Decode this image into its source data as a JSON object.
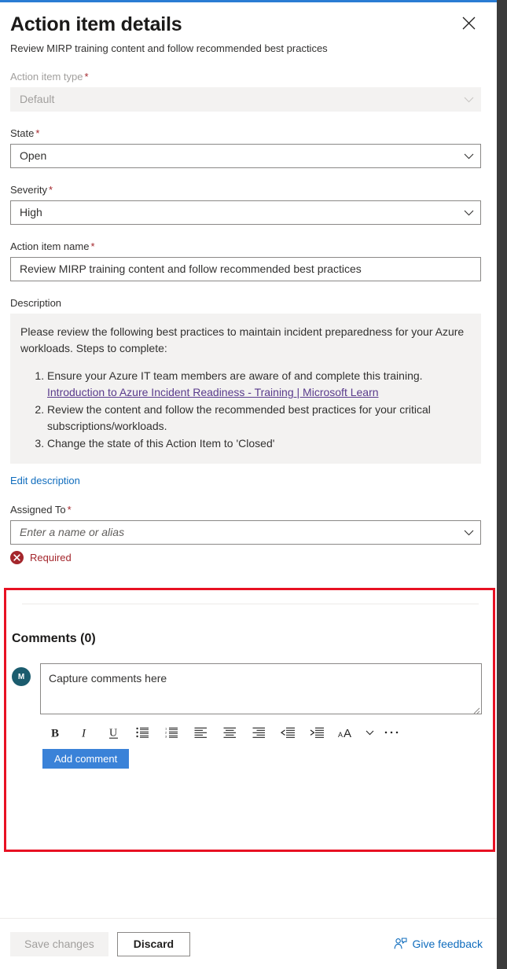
{
  "header": {
    "title": "Action item details",
    "subtitle": "Review MIRP training content and follow recommended best practices",
    "close_label": "Close"
  },
  "fields": {
    "action_item_type": {
      "label": "Action item type",
      "required_mark": "*",
      "value": "Default",
      "disabled": true
    },
    "state": {
      "label": "State",
      "required_mark": "*",
      "value": "Open"
    },
    "severity": {
      "label": "Severity",
      "required_mark": "*",
      "value": "High"
    },
    "action_item_name": {
      "label": "Action item name",
      "required_mark": "*",
      "value": "Review MIRP training content and follow recommended best practices"
    },
    "description": {
      "label": "Description",
      "intro": "Please review the following best practices to maintain incident preparedness for your Azure workloads. Steps to complete:",
      "steps": [
        {
          "text": "Ensure your Azure IT team members are aware of and complete this training.",
          "link": "Introduction to Azure Incident Readiness - Training | Microsoft Learn"
        },
        {
          "text": "Review the content and follow the recommended best practices for your critical subscriptions/workloads.",
          "link": ""
        },
        {
          "text": "Change the state of this Action Item to 'Closed'",
          "link": ""
        }
      ],
      "edit_link": "Edit description"
    },
    "assigned_to": {
      "label": "Assigned To",
      "required_mark": "*",
      "placeholder": "Enter a name or alias",
      "error": "Required"
    }
  },
  "comments": {
    "heading": "Comments (0)",
    "count": 0,
    "avatar_initial": "M",
    "input_placeholder": "Capture comments here",
    "add_button": "Add comment",
    "toolbar": [
      {
        "name": "bold",
        "label": "B"
      },
      {
        "name": "italic",
        "label": "I"
      },
      {
        "name": "underline",
        "label": "U"
      },
      {
        "name": "bulleted-list",
        "label": "Bulleted list"
      },
      {
        "name": "numbered-list",
        "label": "Numbered list"
      },
      {
        "name": "align-left",
        "label": "Align left"
      },
      {
        "name": "align-center",
        "label": "Align center"
      },
      {
        "name": "align-right",
        "label": "Align right"
      },
      {
        "name": "decrease-indent",
        "label": "Decrease indent"
      },
      {
        "name": "increase-indent",
        "label": "Increase indent"
      },
      {
        "name": "font-size",
        "label": "Font size"
      },
      {
        "name": "more-options",
        "label": "More options"
      }
    ]
  },
  "footer": {
    "save_label": "Save changes",
    "discard_label": "Discard",
    "feedback_label": "Give feedback"
  },
  "colors": {
    "accent_blue": "#0f6cbd",
    "button_blue": "#3a82d8",
    "error_red": "#a4262c",
    "highlight_red": "#e81123",
    "avatar_teal": "#1b5c6e",
    "link_purple": "#5a3b8c"
  }
}
